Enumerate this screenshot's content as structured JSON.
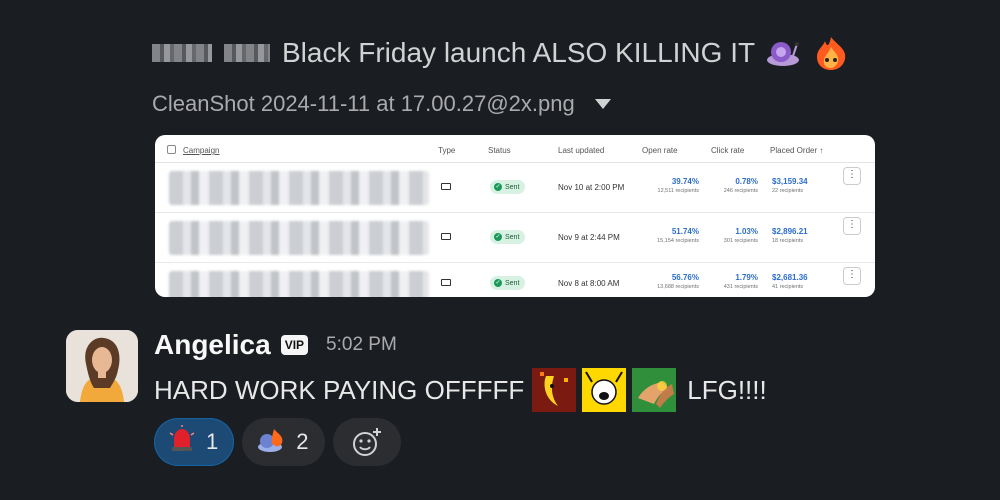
{
  "message1": {
    "text": "Black Friday launch ALSO KILLING IT",
    "emojis": [
      "snail-emoji",
      "fire-emoji"
    ],
    "attachment": {
      "filename": "CleanShot 2024-11-11 at 17.00.27@2x.png",
      "table": {
        "headers": [
          "Campaign",
          "Type",
          "Status",
          "Last updated",
          "Open rate",
          "Click rate",
          "Placed Order ↑"
        ],
        "rows": [
          {
            "status": "Sent",
            "updated": "Nov 10 at 2:00 PM",
            "open_rate": "39.74%",
            "open_sub": "12,511 recipients",
            "click_rate": "0.78%",
            "click_sub": "246 recipients",
            "placed": "$3,159.34",
            "placed_sub": "22 recipients"
          },
          {
            "status": "Sent",
            "updated": "Nov 9 at 2:44 PM",
            "open_rate": "51.74%",
            "open_sub": "15,154 recipients",
            "click_rate": "1.03%",
            "click_sub": "301 recipients",
            "placed": "$2,896.21",
            "placed_sub": "18 recipients"
          },
          {
            "status": "Sent",
            "updated": "Nov 8 at 8:00 AM",
            "open_rate": "56.76%",
            "open_sub": "13,688 recipients",
            "click_rate": "1.79%",
            "click_sub": "431 recipients",
            "placed": "$2,681.36",
            "placed_sub": "41 recipients"
          }
        ]
      }
    }
  },
  "message2": {
    "author": "Angelica",
    "badge": "VIP",
    "time": "5:02 PM",
    "text_before": "HARD WORK PAYING OFFFFF",
    "text_after": "LFG!!!!",
    "emojis": [
      "dancing-banana-emoji",
      "all-the-things-emoji",
      "high-five-emoji"
    ],
    "reactions": [
      {
        "icon": "siren-emoji",
        "count": "1",
        "active": true
      },
      {
        "icon": "fire-snail-emoji",
        "count": "2",
        "active": false
      }
    ]
  },
  "colors": {
    "background": "#1a1d21",
    "text": "#d1d2d3",
    "active_reaction": "#1d4a75",
    "link_blue": "#2c6ecb",
    "sent_badge": "#d7f2e3"
  }
}
